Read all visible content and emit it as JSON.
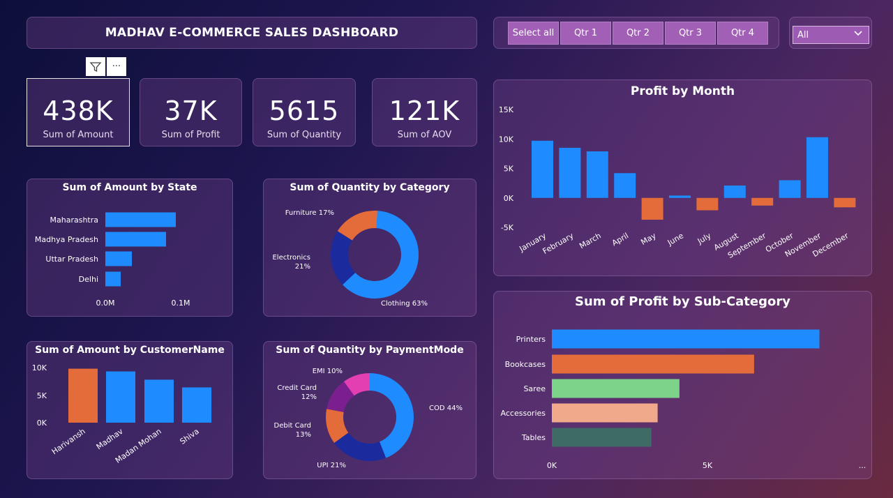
{
  "header": {
    "title": "MADHAV E-COMMERCE SALES DASHBOARD"
  },
  "slicer": {
    "buttons": [
      "Select all",
      "Qtr 1",
      "Qtr 2",
      "Qtr 3",
      "Qtr 4"
    ]
  },
  "dropdown": {
    "value": "All"
  },
  "toolbar": {
    "filter_icon": "filter-icon",
    "more_icon": "more-options-icon",
    "more_glyph": "···"
  },
  "kpis": [
    {
      "value": "438K",
      "label": "Sum of Amount"
    },
    {
      "value": "37K",
      "label": "Sum of Profit"
    },
    {
      "value": "5615",
      "label": "Sum of Quantity"
    },
    {
      "value": "121K",
      "label": "Sum of AOV"
    }
  ],
  "colors": {
    "blue": "#1e8cff",
    "orange": "#e36c3a",
    "navy": "#1b2b9e",
    "green": "#7dd38a",
    "peach": "#f0a98a",
    "teal": "#3f6b66",
    "purple": "#7b1f8f",
    "pink": "#e33fb2"
  },
  "chart_data": [
    {
      "id": "state",
      "type": "bar",
      "orientation": "horizontal",
      "title": "Sum of Amount by State",
      "categories": [
        "Maharashtra",
        "Madhya Pradesh",
        "Uttar Pradesh",
        "Delhi"
      ],
      "values": [
        0.101,
        0.087,
        0.038,
        0.022
      ],
      "unit": "M",
      "xticks": [
        "0.0M",
        "0.1M"
      ],
      "xlim": [
        0,
        0.1
      ]
    },
    {
      "id": "category",
      "type": "pie",
      "donut": true,
      "title": "Sum of Quantity by Category",
      "slices": [
        {
          "label": "Clothing",
          "pct": 63,
          "text": "Clothing 63%",
          "color": "#1e8cff"
        },
        {
          "label": "Electronics",
          "pct": 21,
          "text": "Electronics 21%",
          "color": "#1b2b9e"
        },
        {
          "label": "Furniture",
          "pct": 17,
          "text": "Furniture 17%",
          "color": "#e36c3a"
        }
      ]
    },
    {
      "id": "customer",
      "type": "bar",
      "title": "Sum of Amount by CustomerName",
      "categories": [
        "Harivansh",
        "Madhav",
        "Madan Mohan",
        "Shiva"
      ],
      "values": [
        9800,
        9300,
        7800,
        6400
      ],
      "colors": [
        "#e36c3a",
        "#1e8cff",
        "#1e8cff",
        "#1e8cff"
      ],
      "yticks": [
        "10K",
        "5K",
        "0K"
      ],
      "ylim": [
        0,
        10000
      ]
    },
    {
      "id": "payment",
      "type": "pie",
      "donut": true,
      "title": "Sum of Quantity by PaymentMode",
      "slices": [
        {
          "label": "COD",
          "pct": 44,
          "text": "COD 44%",
          "color": "#1e8cff"
        },
        {
          "label": "UPI",
          "pct": 21,
          "text": "UPI 21%",
          "color": "#1b2b9e"
        },
        {
          "label": "Debit Card",
          "pct": 13,
          "text": "Debit Card 13%",
          "color": "#e36c3a"
        },
        {
          "label": "Credit Card",
          "pct": 12,
          "text": "Credit Card 12%",
          "color": "#7b1f8f"
        },
        {
          "label": "EMI",
          "pct": 10,
          "text": "EMI 10%",
          "color": "#e33fb2"
        }
      ]
    },
    {
      "id": "month",
      "type": "bar",
      "title": "Profit by Month",
      "categories": [
        "January",
        "February",
        "March",
        "April",
        "May",
        "June",
        "July",
        "August",
        "September",
        "October",
        "November",
        "December"
      ],
      "values": [
        9700,
        8500,
        7900,
        4200,
        -3700,
        400,
        -2100,
        2100,
        -1300,
        3000,
        10300,
        -1600
      ],
      "yticks": [
        "15K",
        "10K",
        "5K",
        "0K",
        "-5K"
      ],
      "ylim": [
        -5000,
        15000
      ],
      "positive_color": "#1e8cff",
      "negative_color": "#e36c3a"
    },
    {
      "id": "subcategory",
      "type": "bar",
      "orientation": "horizontal",
      "title": "Sum of Profit by Sub-Category",
      "categories": [
        "Printers",
        "Bookcases",
        "Saree",
        "Accessories",
        "Tables"
      ],
      "values": [
        8600,
        6500,
        4100,
        3400,
        3200
      ],
      "colors": [
        "#1e8cff",
        "#e36c3a",
        "#7dd38a",
        "#f0a98a",
        "#3f6b66"
      ],
      "xticks": [
        "0K",
        "5K"
      ],
      "xlim": [
        0,
        5000
      ],
      "overflow_marker": "..."
    }
  ]
}
